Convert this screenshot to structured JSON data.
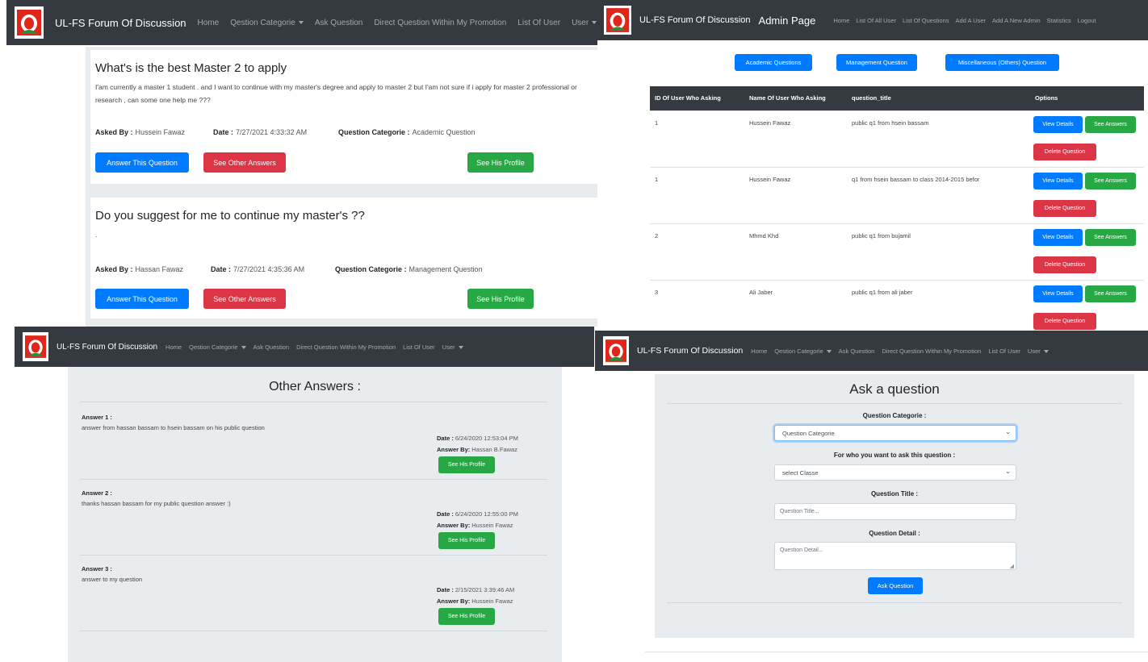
{
  "brand": "UL-FS Forum Of Discussion",
  "user_nav": [
    {
      "label": "Home",
      "dropdown": false
    },
    {
      "label": "Qestion Categorie",
      "dropdown": true
    },
    {
      "label": "Ask Question",
      "dropdown": false
    },
    {
      "label": "Direct Question Within My Promotion",
      "dropdown": false
    },
    {
      "label": "List Of User",
      "dropdown": false
    },
    {
      "label": "User",
      "dropdown": true
    }
  ],
  "questions": [
    {
      "title": "What's is the best Master 2 to apply",
      "body": "I'am currently a master 1 student . and I want to continue with my master's degree and apply to master 2 but I'am not sure if i apply for master 2 professional or research , can some one help me ???",
      "asked_by_label": "Asked By :",
      "asked_by": "Hussein Fawaz",
      "date_label": "Date :",
      "date": "7/27/2021 4:33:32 AM",
      "category_label": "Question Categorie :",
      "category": "Academic Question",
      "answer_btn": "Answer This Question",
      "other_btn": "See Other Answers",
      "profile_btn": "See His Profile"
    },
    {
      "title": "Do you suggest for me to continue my master's ??",
      "body": ".",
      "asked_by_label": "Asked By :",
      "asked_by": "Hassan Fawaz",
      "date_label": "Date :",
      "date": "7/27/2021 4:35:36 AM",
      "category_label": "Question Categorie :",
      "category": "Management Question",
      "answer_btn": "Answer This Question",
      "other_btn": "See Other Answers",
      "profile_btn": "See His Profile"
    }
  ],
  "admin": {
    "page_title": "Admin Page",
    "nav": [
      "Home",
      "List Of All User",
      "List Of Questions",
      "Add A User",
      "Add A New Admin",
      "Statistics",
      "Logout"
    ],
    "filters": [
      "Academic Questions",
      "Management Question",
      "Miscellaneous (Others) Question"
    ],
    "columns": [
      "ID Of User Who Asking",
      "Name Of User Who Asking",
      "question_title",
      "Options"
    ],
    "rows": [
      {
        "id": "1",
        "name": "Hussein Fawaz",
        "title": "public q1 from hsein bassam"
      },
      {
        "id": "1",
        "name": "Hussein Fawaz",
        "title": "q1 from hsein bassam to class 2014-2015 befor"
      },
      {
        "id": "2",
        "name": "Mhmd Khd",
        "title": "public q1 from bujamil"
      },
      {
        "id": "3",
        "name": "Ali Jaber",
        "title": "public q1 from ali jaber"
      }
    ],
    "view_btn": "View Details",
    "answers_btn": "See Answers",
    "delete_btn": "Delete Question"
  },
  "answers_page": {
    "title": "Other Answers :",
    "answers": [
      {
        "label": "Answer 1 :",
        "text": "answer from hassan bassam to hsein bassam on his public question",
        "date_label": "Date :",
        "date": "6/24/2020 12:53:04 PM",
        "by_label": "Answer By:",
        "by": "Hassan B.Fawaz",
        "btn": "See His Profile"
      },
      {
        "label": "Answer 2 :",
        "text": "thanks hassan bassam for my public question answer :)",
        "date_label": "Date :",
        "date": "6/24/2020 12:55:00 PM",
        "by_label": "Answer By:",
        "by": "Hussein Fawaz",
        "btn": "See His Profile"
      },
      {
        "label": "Answer 3 :",
        "text": "answer to my question",
        "date_label": "Date :",
        "date": "2/15/2021 3:39:46 AM",
        "by_label": "Answer By:",
        "by": "Hussein Fawaz",
        "btn": "See His Profile"
      }
    ]
  },
  "ask_page": {
    "title": "Ask a question",
    "category_label": "Question Categorie :",
    "category_value": "Question Categorie",
    "for_who_label": "For who you want to ask this question :",
    "for_who_value": "select Classe",
    "title_label": "Question Title :",
    "title_placeholder": "Question Title...",
    "detail_label": "Question Detail :",
    "detail_placeholder": "Question Detail...",
    "submit": "Ask Question"
  },
  "colors": {
    "navbar": "#343a40",
    "primary": "#007bff",
    "danger": "#dc3545",
    "success": "#28a745",
    "panel_gray": "#e9ecef",
    "logo_red": "#e0261b",
    "logo_green": "#2e8b3a"
  }
}
